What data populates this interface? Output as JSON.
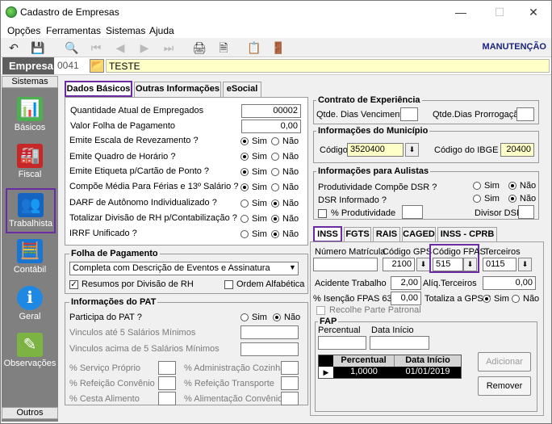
{
  "window": {
    "title": "Cadastro de Empresas",
    "min": "—",
    "max": "☐",
    "close": "✕"
  },
  "menu": [
    "Opções",
    "Ferramentas",
    "Sistemas",
    "Ajuda"
  ],
  "toolbar": {
    "mode": "MANUTENÇÃO"
  },
  "empresa": {
    "label": "Empresa",
    "code": "0041",
    "name": "TESTE"
  },
  "sidebar": {
    "head_top": "Sistemas",
    "head_bottom": "Outros",
    "items": [
      "Básicos",
      "Fiscal",
      "Trabalhista",
      "Contábil",
      "Geral",
      "Observações"
    ]
  },
  "tabs": [
    "Dados Básicos",
    "Outras Informações",
    "eSocial"
  ],
  "basic": {
    "qtd_label": "Quantidade Atual de Empregados",
    "qtd_value": "00002",
    "folha_label": "Valor Folha de Pagamento",
    "folha_value": "0,00",
    "yes": "Sim",
    "no": "Não",
    "q1": "Emite Escala de Revezamento ?",
    "q2": "Emite Quadro de Horário ?",
    "q3": "Emite Etiqueta p/Cartão de Ponto ?",
    "q4": "Compõe Média Para Férias e 13º Salário ?",
    "q5": "DARF de Autônomo Individualizado ?",
    "q6": "Totalizar Divisão de RH p/Contabilização ?",
    "q7": "IRRF Unificado ?"
  },
  "folha": {
    "title": "Folha de Pagamento",
    "select": "Completa com Descrição de Eventos e Assinatura",
    "resumos": "Resumos por Divisão de RH",
    "ordem": "Ordem Alfabética"
  },
  "pat": {
    "title": "Informações do PAT",
    "participa": "Participa do PAT ?",
    "v1": "Vinculos até 5 Salários Mínimos",
    "v2": "Vinculos acima de 5 Salários Mínimos",
    "s1": "% Serviço Próprio",
    "s2": "% Refeição Convênio",
    "s3": "% Cesta Alimento",
    "a1": "% Administração Cozinha",
    "a2": "% Refeição Transporte",
    "a3": "% Alimentação Convênio"
  },
  "contrato": {
    "title": "Contrato de Experiência",
    "dias": "Qtde. Dias Vencimento",
    "prorrog": "Qtde.Dias Prorrogação"
  },
  "municipio": {
    "title": "Informações do Município",
    "codigo_label": "Código",
    "codigo": "3520400",
    "ibge_label": "Código do IBGE",
    "ibge": "20400"
  },
  "aulistas": {
    "title": "Informações para Aulistas",
    "prod": "Produtividade Compõe DSR ?",
    "dsr": "DSR Informado ?",
    "pct": "% Produtividade",
    "div": "Divisor DSR"
  },
  "tabs2": [
    "INSS",
    "FGTS",
    "RAIS",
    "CAGED",
    "INSS - CPRB"
  ],
  "inss": {
    "matricula": "Número Matrícula",
    "gps_label": "Código GPS",
    "gps": "2100",
    "fpas_label": "Código FPAS",
    "fpas": "515",
    "terc_label": "Terceiros",
    "terc": "0115",
    "acid_label": "Acidente Trabalho",
    "acid": "2,00",
    "aliq": "Alíq.Terceiros",
    "aliq_value": "0,00",
    "isencao": "% Isenção FPAS 639",
    "isencao_value": "0,00",
    "totaliza": "Totaliza a GPS ?",
    "recolhe": "Recolhe Parte Patronal",
    "fap_title": "FAP",
    "fap_pct": "Percentual",
    "fap_data": "Data Início",
    "col1": "Percentual",
    "col2": "Data Início",
    "row_pct": "1,0000",
    "row_data": "01/01/2019",
    "adicionar": "Adicionar",
    "remover": "Remover"
  },
  "colors": {
    "highlight": "#6a2ca0",
    "brand": "#1a237e",
    "field_yellow": "#ffffc8"
  }
}
